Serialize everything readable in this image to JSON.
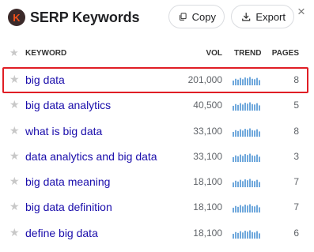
{
  "header": {
    "logo_letter": "K",
    "title": "SERP Keywords",
    "copy_label": "Copy",
    "export_label": "Export",
    "close_glyph": "×"
  },
  "table": {
    "columns": {
      "keyword": "KEYWORD",
      "vol": "VOL",
      "trend": "TREND",
      "pages": "PAGES"
    },
    "rows": [
      {
        "keyword": "big data",
        "vol": "201,000",
        "pages": "8",
        "highlighted": true
      },
      {
        "keyword": "big data analytics",
        "vol": "40,500",
        "pages": "5"
      },
      {
        "keyword": "what is big data",
        "vol": "33,100",
        "pages": "8"
      },
      {
        "keyword": "data analytics and big data",
        "vol": "33,100",
        "pages": "3"
      },
      {
        "keyword": "big data meaning",
        "vol": "18,100",
        "pages": "7"
      },
      {
        "keyword": "big data definition",
        "vol": "18,100",
        "pages": "7"
      },
      {
        "keyword": "define big data",
        "vol": "18,100",
        "pages": "6"
      }
    ]
  },
  "colors": {
    "link": "#1a0dab",
    "trend_bar": "#6fa8dc",
    "highlight": "#e01e25",
    "logo_bg": "#3b2a2a",
    "logo_letter": "#f2511b"
  }
}
